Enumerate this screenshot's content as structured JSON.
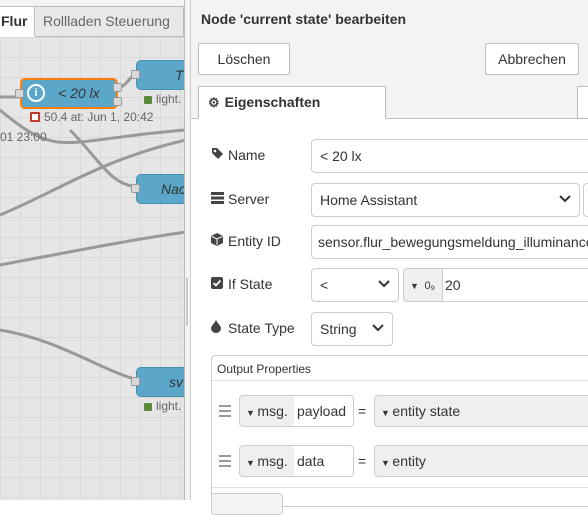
{
  "canvas": {
    "tabs": [
      "Flur",
      "Rollladen Steuerung"
    ],
    "nodes": {
      "lux_label": "< 20 lx",
      "t_label": "T",
      "nac_label": "Nac",
      "sv_label": "sv",
      "lux_status": "50.4 at: Jun 1, 20:42",
      "light1_status": "light.",
      "light2_status": "light.",
      "timestamp_fragment": "01 23:00"
    }
  },
  "tray": {
    "title": "Node 'current state' bearbeiten",
    "delete_label": "Löschen",
    "cancel_label": "Abbrechen",
    "tab_label": "Eigenschaften",
    "tab_icon": "gear-icon",
    "fields": {
      "name_label": "Name",
      "name_value": "< 20 lx",
      "server_label": "Server",
      "server_value": "Home Assistant",
      "entity_label": "Entity ID",
      "entity_value": "sensor.flur_bewegungsmeldung_illuminance",
      "ifstate_label": "If State",
      "ifstate_operator": "<",
      "ifstate_type_glyph": "0₉",
      "ifstate_value": "20",
      "statetype_label": "State Type",
      "statetype_value": "String"
    },
    "output": {
      "title": "Output Properties",
      "rows": [
        {
          "prefix": "msg.",
          "property": "payload",
          "eq": "=",
          "value": "entity state"
        },
        {
          "prefix": "msg.",
          "property": "data",
          "eq": "=",
          "value": "entity"
        }
      ]
    }
  },
  "colors": {
    "node_blue": "#5ba7c9",
    "node_selected": "#ff7f0e",
    "status_red": "#c0392b",
    "status_green": "#5a8a3a"
  }
}
